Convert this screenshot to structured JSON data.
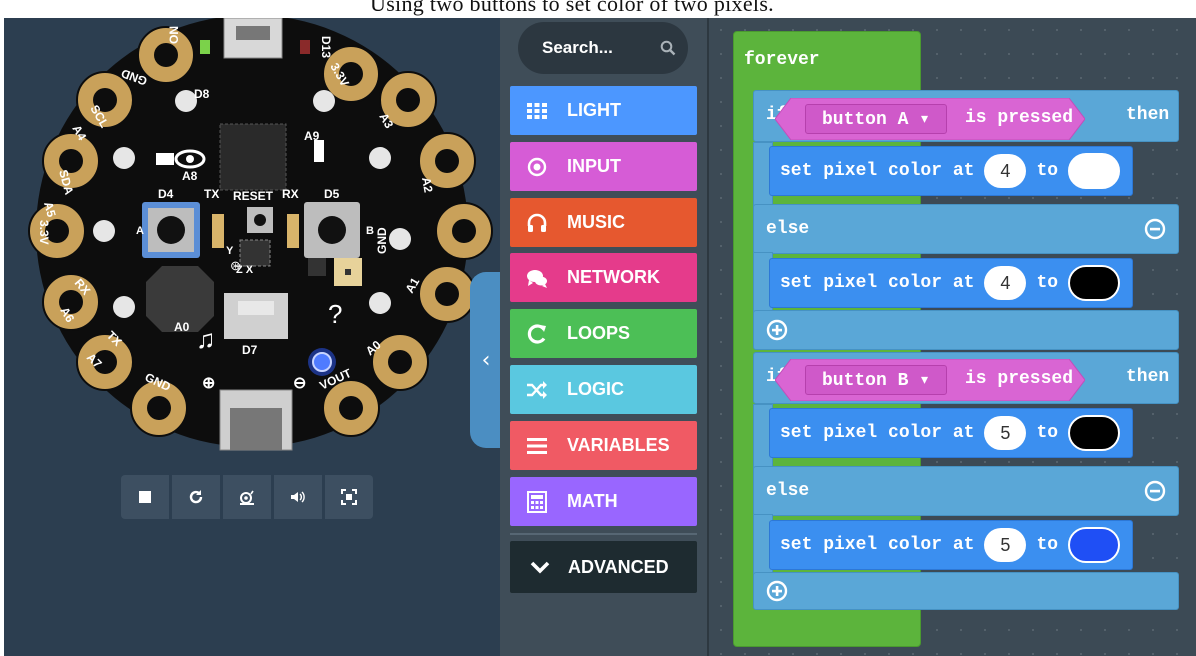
{
  "page_caption": "Using two buttons to set color of two pixels.",
  "simulator": {
    "board_labels": {
      "on": "ON",
      "d13": "D13",
      "gnd_top": "GND",
      "d8": "D8",
      "v33_top": "3.3V",
      "scl": "SCL",
      "a4": "A4",
      "a3": "A3",
      "a9": "A9",
      "sda": "SDA",
      "a8": "A8",
      "a5": "A5",
      "a2": "A2",
      "d4": "D4",
      "tx_top": "TX",
      "reset": "RESET",
      "rx_top": "RX",
      "d5": "D5",
      "v33_left": "3.3V",
      "gnd_right": "GND",
      "a_mark": "A",
      "b_mark": "B",
      "axis_y": "Y",
      "axis_zx": "Z X",
      "rx_left": "RX",
      "a6": "A6",
      "a1": "A1",
      "a0_label": "A0",
      "tx_left": "TX",
      "a7": "A7",
      "d7": "D7",
      "a0_right": "A0",
      "gnd_bottom": "GND",
      "vout": "VOUT"
    },
    "controls": [
      "stop",
      "restart",
      "slow-mode",
      "mute",
      "fullscreen"
    ],
    "led_color": "#2b59ff"
  },
  "toolbox": {
    "search_placeholder": "Search...",
    "categories": [
      {
        "label": "LIGHT",
        "color": "#4c97ff",
        "icon": "grid-icon"
      },
      {
        "label": "INPUT",
        "color": "#d65cd6",
        "icon": "target-icon"
      },
      {
        "label": "MUSIC",
        "color": "#e6582f",
        "icon": "headphones-icon"
      },
      {
        "label": "NETWORK",
        "color": "#e53b8b",
        "icon": "chat-icon"
      },
      {
        "label": "LOOPS",
        "color": "#4cbf56",
        "icon": "loop-icon"
      },
      {
        "label": "LOGIC",
        "color": "#5ac8e0",
        "icon": "shuffle-icon"
      },
      {
        "label": "VARIABLES",
        "color": "#f05a64",
        "icon": "list-icon"
      },
      {
        "label": "MATH",
        "color": "#9966ff",
        "icon": "calculator-icon"
      }
    ],
    "advanced_label": "ADVANCED"
  },
  "workspace": {
    "forever_label": "forever",
    "if_label": "if",
    "then_label": "then",
    "else_label": "else",
    "is_pressed_label": "is pressed",
    "set_pixel_label": "set pixel color at",
    "to_label": "to",
    "if_blocks": [
      {
        "button": "button A ▾",
        "then_pixel": "4",
        "then_color": "#ffffff",
        "else_pixel": "4",
        "else_color": "#000000"
      },
      {
        "button": "button B ▾",
        "then_pixel": "5",
        "then_color": "#000000",
        "else_pixel": "5",
        "else_color": "#1f4ff5"
      }
    ]
  }
}
